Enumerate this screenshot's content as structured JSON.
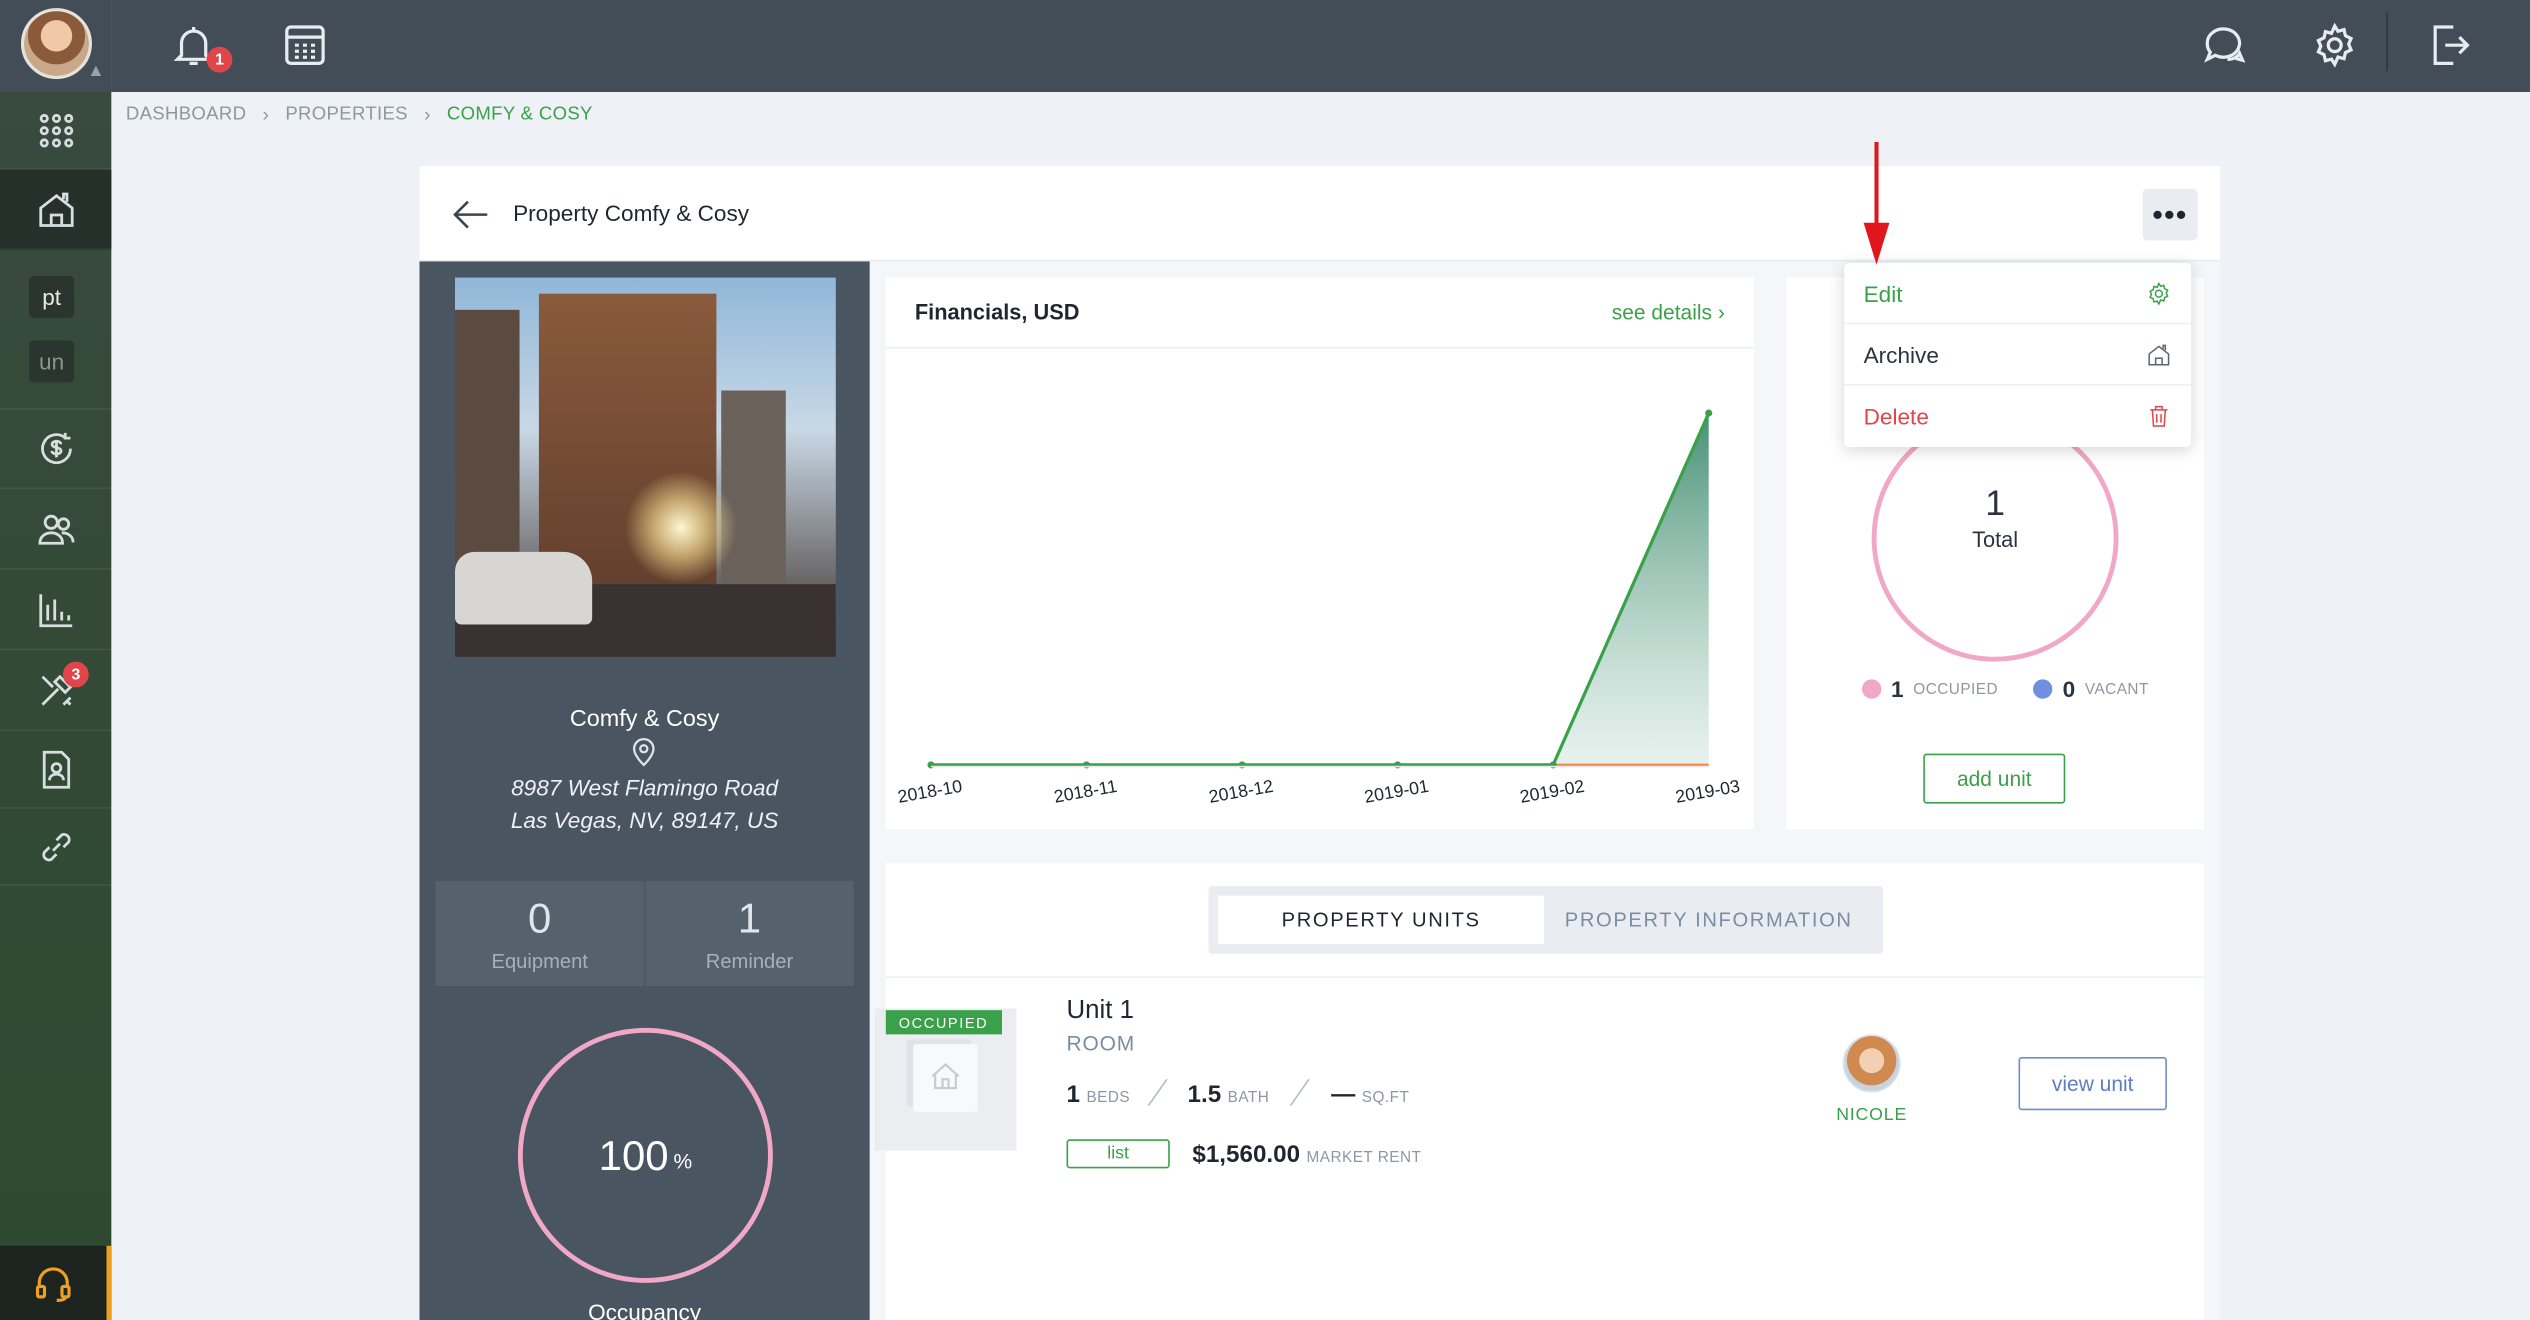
{
  "topbar": {
    "notification_count": "1",
    "icons": [
      "bell-icon",
      "calendar-icon",
      "chat-icon",
      "gear-icon",
      "logout-icon"
    ]
  },
  "sidebar": {
    "chips": [
      "pt",
      "un"
    ],
    "maintenance_badge": "3",
    "icons": [
      "apps-grid-icon",
      "property-icon",
      "finance-icon",
      "people-icon",
      "reports-icon",
      "tools-icon",
      "documents-icon",
      "link-icon",
      "support-headset-icon"
    ]
  },
  "breadcrumb": {
    "items": [
      "DASHBOARD",
      "PROPERTIES",
      "COMFY & COSY"
    ]
  },
  "header": {
    "title": "Property Comfy & Cosy",
    "more_label": "•••"
  },
  "dropdown": {
    "items": [
      {
        "label": "Edit",
        "color": "#3aa14a",
        "icon": "gear-icon"
      },
      {
        "label": "Archive",
        "color": "#2b3340",
        "icon": "archive-house-icon"
      },
      {
        "label": "Delete",
        "color": "#e0454a",
        "icon": "trash-icon"
      }
    ]
  },
  "property": {
    "name": "Comfy & Cosy",
    "address_line1": "8987 West Flamingo Road",
    "address_line2": "Las Vegas, NV, 89147, US",
    "stats": [
      {
        "value": "0",
        "label": "Equipment"
      },
      {
        "value": "1",
        "label": "Reminder"
      }
    ],
    "occupancy_value": "100",
    "occupancy_unit": "%",
    "occupancy_label": "Occupancy"
  },
  "financials": {
    "title": "Financials, USD",
    "link": "see details ›"
  },
  "chart_data": {
    "type": "area",
    "title": "Financials, USD",
    "categories": [
      "2018-10",
      "2018-11",
      "2018-12",
      "2019-01",
      "2019-02",
      "2019-03"
    ],
    "series": [
      {
        "name": "",
        "color": "#3aa14a",
        "values": [
          0,
          0,
          0,
          0,
          0,
          1
        ]
      },
      {
        "name": "",
        "color": "#f08a3c",
        "values": [
          0,
          0,
          0,
          0,
          0,
          0
        ]
      }
    ],
    "grid": false
  },
  "units_summary": {
    "total": "1",
    "total_label": "Total",
    "occupied_count": "1",
    "occupied_label": "OCCUPIED",
    "vacant_count": "0",
    "vacant_label": "VACANT",
    "occupied_color": "#f0a8c6",
    "vacant_color": "#6f8fe0",
    "add_unit_label": "add unit"
  },
  "tabs": {
    "units": "PROPERTY UNITS",
    "info": "PROPERTY INFORMATION"
  },
  "unit": {
    "status": "OCCUPIED",
    "name": "Unit 1",
    "type": "ROOM",
    "beds": "1",
    "beds_label": "BEDS",
    "bath": "1.5",
    "bath_label": "BATH",
    "sqft": "—",
    "sqft_label": "SQ.FT",
    "list_label": "list",
    "rent": "$1,560.00",
    "rent_label": "MARKET RENT",
    "tenant": "NICOLE",
    "view_label": "view unit"
  }
}
